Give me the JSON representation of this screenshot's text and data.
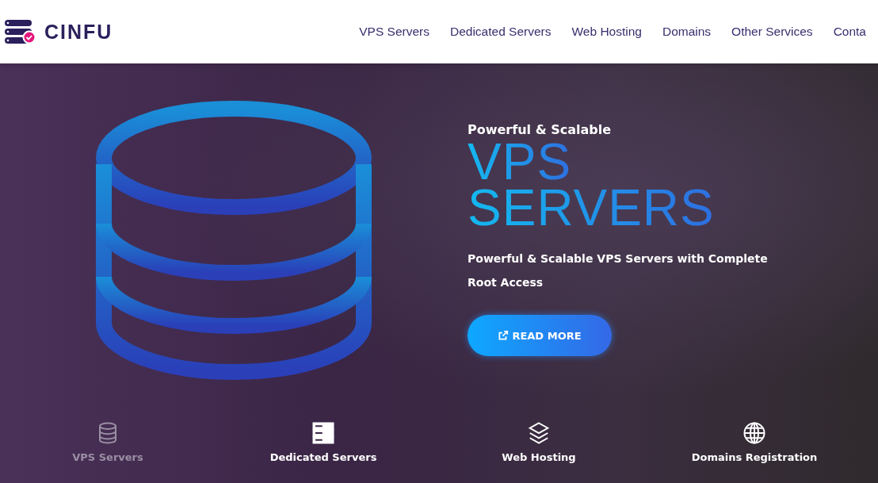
{
  "header": {
    "logo_text": "CINFU",
    "nav": [
      "VPS Servers",
      "Dedicated Servers",
      "Web Hosting",
      "Domains",
      "Other Services",
      "Conta"
    ]
  },
  "hero": {
    "eyebrow": "Powerful & Scalable",
    "title_lines": [
      "VPS",
      "SERVERS"
    ],
    "description": "Powerful & Scalable VPS Servers with Complete Root Access",
    "button": "READ MORE"
  },
  "features": [
    {
      "kind": "database",
      "label": "VPS Servers",
      "selected": true
    },
    {
      "kind": "servers",
      "label": "Dedicated Servers",
      "selected": false
    },
    {
      "kind": "layers",
      "label": "Web Hosting",
      "selected": false
    },
    {
      "kind": "globe",
      "label": "Domains Registration",
      "selected": false
    }
  ]
}
